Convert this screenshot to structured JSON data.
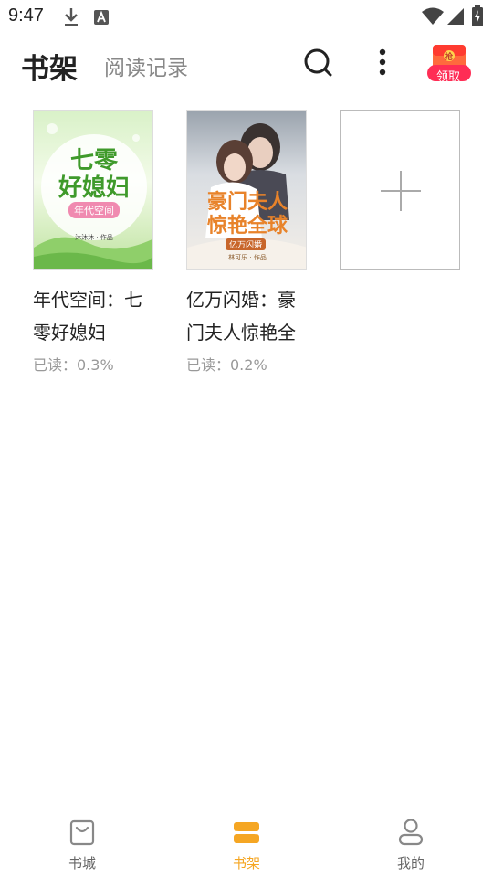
{
  "status_bar": {
    "time": "9:47"
  },
  "header": {
    "tabs": [
      {
        "label": "书架",
        "active": true
      },
      {
        "label": "阅读记录",
        "active": false
      }
    ],
    "reward_badge": {
      "top": "抢",
      "label": "领取"
    }
  },
  "books": [
    {
      "title": "年代空间：七零好媳妇",
      "progress": "已读：0.3%",
      "cover": {
        "line1": "七零",
        "line2": "好媳妇",
        "ribbon": "年代空间",
        "author": "沐沐沐 · 作品"
      }
    },
    {
      "title": "亿万闪婚：豪门夫人惊艳全球",
      "progress": "已读：0.2%",
      "cover": {
        "line1": "豪门夫人",
        "line2": "惊艳全球",
        "ribbon": "亿万闪婚",
        "author": "林可乐 · 作品"
      }
    }
  ],
  "bottom_nav": [
    {
      "label": "书城",
      "icon": "bag-icon",
      "active": false
    },
    {
      "label": "书架",
      "icon": "bookshelf-icon",
      "active": true
    },
    {
      "label": "我的",
      "icon": "person-icon",
      "active": false
    }
  ],
  "colors": {
    "accent": "#f5a623",
    "muted_text": "#999999",
    "inactive_tab": "#888888"
  }
}
